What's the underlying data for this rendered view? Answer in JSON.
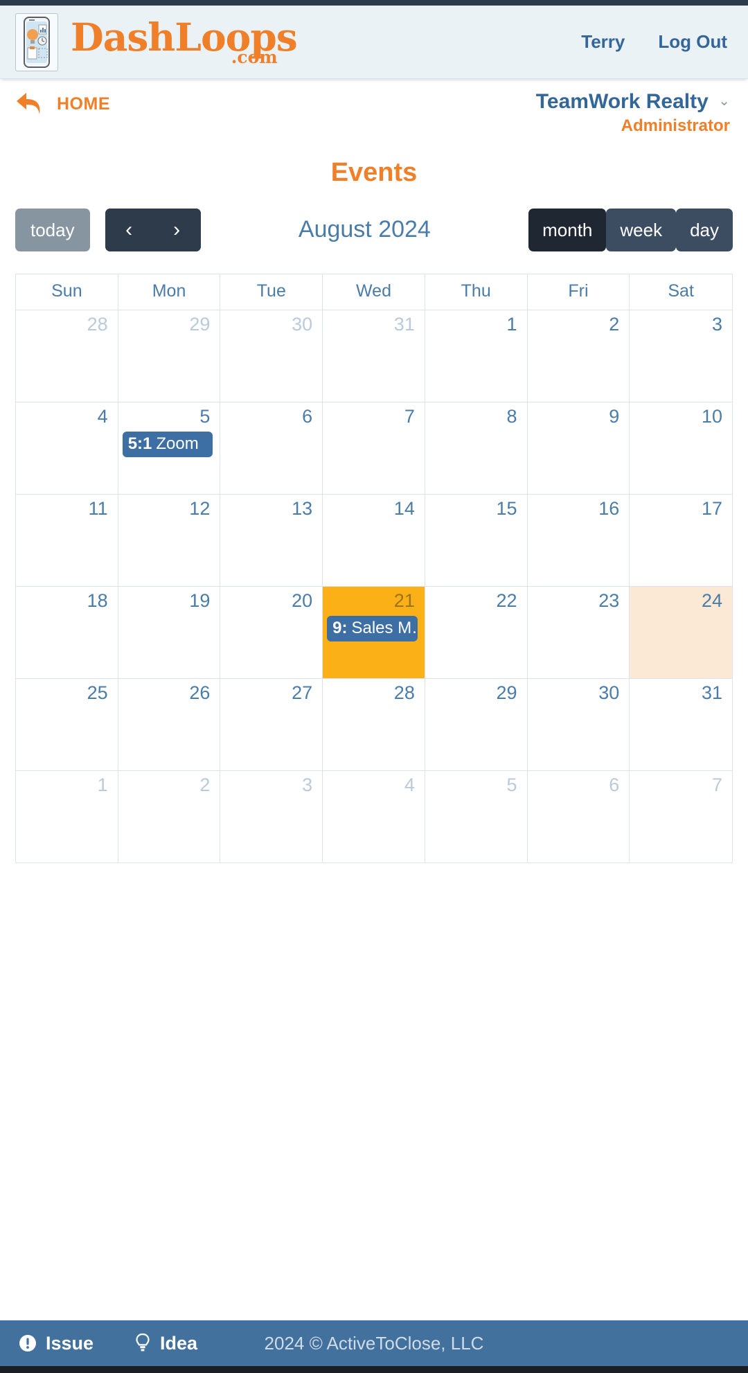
{
  "brand": {
    "name": "DashLoops",
    "tld": ".com",
    "logo_icon": "phone-ideas-logo-icon"
  },
  "header": {
    "user_label": "Terry",
    "logout_label": "Log Out"
  },
  "subheader": {
    "home_label": "HOME",
    "home_icon": "back-arrow-icon",
    "org_name": "TeamWork Realty",
    "org_caret_icon": "chevron-down-icon",
    "role_label": "Administrator"
  },
  "page": {
    "title": "Events"
  },
  "toolbar": {
    "today_label": "today",
    "prev_icon": "chevron-left-icon",
    "prev_label": "‹",
    "next_icon": "chevron-right-icon",
    "next_label": "›",
    "period_title": "August 2024",
    "views": [
      {
        "label": "month",
        "active": true
      },
      {
        "label": "week",
        "active": false
      },
      {
        "label": "day",
        "active": false
      }
    ]
  },
  "calendar": {
    "weekday_headers": [
      "Sun",
      "Mon",
      "Tue",
      "Wed",
      "Thu",
      "Fri",
      "Sat"
    ],
    "weeks": [
      [
        {
          "day": "28",
          "other": true
        },
        {
          "day": "29",
          "other": true
        },
        {
          "day": "30",
          "other": true
        },
        {
          "day": "31",
          "other": true
        },
        {
          "day": "1"
        },
        {
          "day": "2"
        },
        {
          "day": "3"
        }
      ],
      [
        {
          "day": "4"
        },
        {
          "day": "5",
          "events": [
            {
              "time": "5:1",
              "title": "Zoom"
            }
          ]
        },
        {
          "day": "6"
        },
        {
          "day": "7"
        },
        {
          "day": "8"
        },
        {
          "day": "9"
        },
        {
          "day": "10"
        }
      ],
      [
        {
          "day": "11"
        },
        {
          "day": "12"
        },
        {
          "day": "13"
        },
        {
          "day": "14"
        },
        {
          "day": "15"
        },
        {
          "day": "16"
        },
        {
          "day": "17"
        }
      ],
      [
        {
          "day": "18"
        },
        {
          "day": "19"
        },
        {
          "day": "20"
        },
        {
          "day": "21",
          "today": true,
          "events": [
            {
              "time": "9:",
              "title": "Sales M…"
            }
          ]
        },
        {
          "day": "22"
        },
        {
          "day": "23"
        },
        {
          "day": "24",
          "highlight": true
        }
      ],
      [
        {
          "day": "25"
        },
        {
          "day": "26"
        },
        {
          "day": "27"
        },
        {
          "day": "28"
        },
        {
          "day": "29"
        },
        {
          "day": "30"
        },
        {
          "day": "31"
        }
      ],
      [
        {
          "day": "1",
          "other": true
        },
        {
          "day": "2",
          "other": true
        },
        {
          "day": "3",
          "other": true
        },
        {
          "day": "4",
          "other": true
        },
        {
          "day": "5",
          "other": true
        },
        {
          "day": "6",
          "other": true
        },
        {
          "day": "7",
          "other": true
        }
      ]
    ]
  },
  "footer": {
    "issue_label": "Issue",
    "issue_icon": "exclamation-circle-icon",
    "idea_label": "Idea",
    "idea_icon": "lightbulb-icon",
    "copyright": "2024 © ActiveToClose, LLC"
  },
  "colors": {
    "brand_orange": "#ef7f28",
    "link_blue": "#336699",
    "dark_navy": "#2e3b4b",
    "today_yellow": "#fbb018",
    "highlight_peach": "#fbe8d5",
    "event_blue": "#3d6fa5",
    "footer_blue": "#43719e"
  }
}
